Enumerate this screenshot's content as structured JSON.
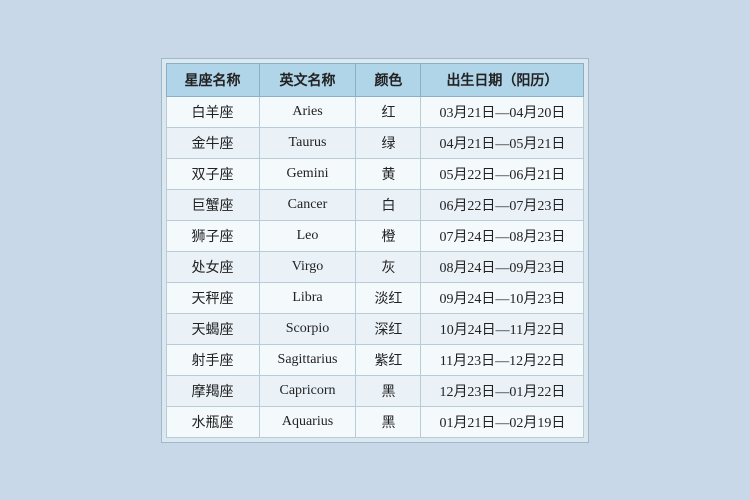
{
  "table": {
    "headers": [
      "星座名称",
      "英文名称",
      "颜色",
      "出生日期（阳历）"
    ],
    "rows": [
      [
        "白羊座",
        "Aries",
        "红",
        "03月21日—04月20日"
      ],
      [
        "金牛座",
        "Taurus",
        "绿",
        "04月21日—05月21日"
      ],
      [
        "双子座",
        "Gemini",
        "黄",
        "05月22日—06月21日"
      ],
      [
        "巨蟹座",
        "Cancer",
        "白",
        "06月22日—07月23日"
      ],
      [
        "狮子座",
        "Leo",
        "橙",
        "07月24日—08月23日"
      ],
      [
        "处女座",
        "Virgo",
        "灰",
        "08月24日—09月23日"
      ],
      [
        "天秤座",
        "Libra",
        "淡红",
        "09月24日—10月23日"
      ],
      [
        "天蝎座",
        "Scorpio",
        "深红",
        "10月24日—11月22日"
      ],
      [
        "射手座",
        "Sagittarius",
        "紫红",
        "11月23日—12月22日"
      ],
      [
        "摩羯座",
        "Capricorn",
        "黑",
        "12月23日—01月22日"
      ],
      [
        "水瓶座",
        "Aquarius",
        "黑",
        "01月21日—02月19日"
      ]
    ]
  }
}
